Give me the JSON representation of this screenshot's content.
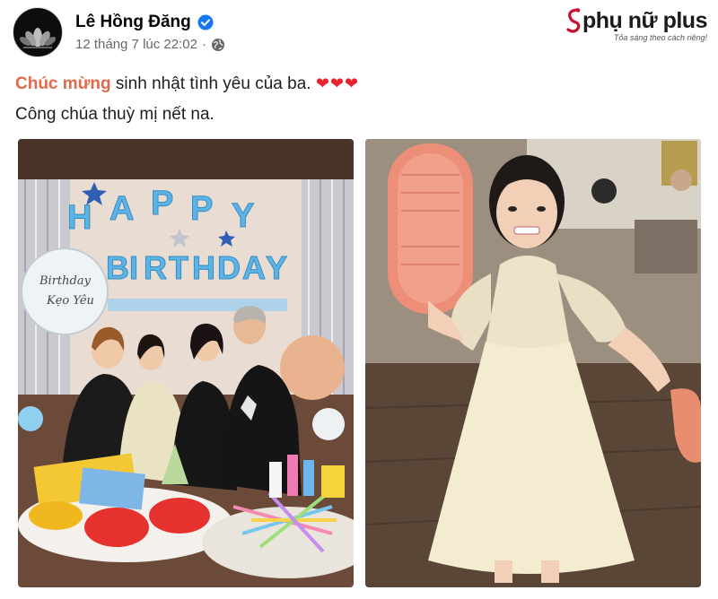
{
  "post": {
    "author_name": "Lê Hồng Đăng",
    "timestamp": "12 tháng 7 lúc 22:02",
    "separator": "·",
    "icons": {
      "verified": "verified-badge-icon",
      "audience": "globe-icon",
      "avatar": "lotus-avatar"
    },
    "caption_line1_highlight": "Chúc mừng",
    "caption_line1_rest": " sinh nhật tình yêu của ba.",
    "caption_hearts": "❤❤❤",
    "caption_line2": "Công chúa thuỳ mị nết na."
  },
  "brand": {
    "name": "phụ nữ plus",
    "tagline": "Tỏa sáng theo cách riêng!"
  },
  "photos": {
    "left": {
      "banner_letters_top": [
        "H",
        "A",
        "P",
        "P",
        "Y"
      ],
      "banner_letters_bottom": [
        "B",
        "I",
        "R",
        "T",
        "H",
        "D",
        "A",
        "Y"
      ],
      "balloon_text_1": "Birthday",
      "balloon_text_2": "Kẹo Yêu"
    },
    "right": {}
  },
  "colors": {
    "highlight": "#e26a4b",
    "heart": "#e8232c",
    "verified": "#1877f2",
    "meta": "#65676b",
    "banner": "#5cb3e6"
  }
}
